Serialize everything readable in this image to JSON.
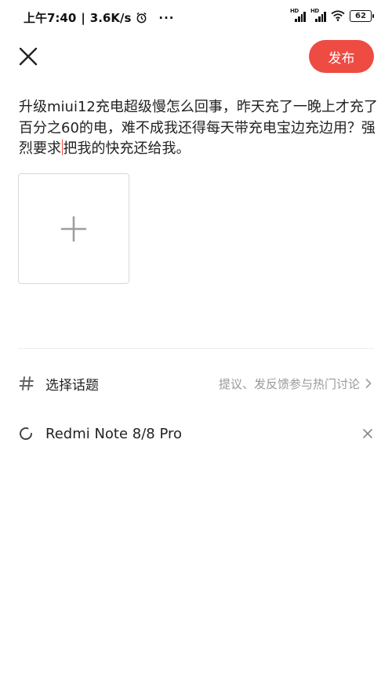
{
  "status_bar": {
    "time": "上午7:40",
    "separator": "|",
    "network_speed": "3.6K/s",
    "more": "···",
    "signal1_label": "HD",
    "signal2_label": "HD",
    "battery": "62"
  },
  "header": {
    "close_icon": "close-icon",
    "publish_label": "发布",
    "accent_color": "#ee4b43"
  },
  "post": {
    "text_before_cursor": "升级miui12充电超级慢怎么回事，昨天充了一晚上才充了百分之60的电，难不成我还得每天带充电宝边充边用？强烈要求",
    "text_after_cursor": "把我的快充还给我。"
  },
  "add_image": {
    "icon": "plus-icon"
  },
  "topic": {
    "icon": "hash-icon",
    "label": "选择话题",
    "hint": "提议、发反馈参与热门讨论"
  },
  "device": {
    "icon": "loading-icon",
    "label": "Redmi Note 8/8 Pro",
    "remove_icon": "close-small-icon"
  }
}
